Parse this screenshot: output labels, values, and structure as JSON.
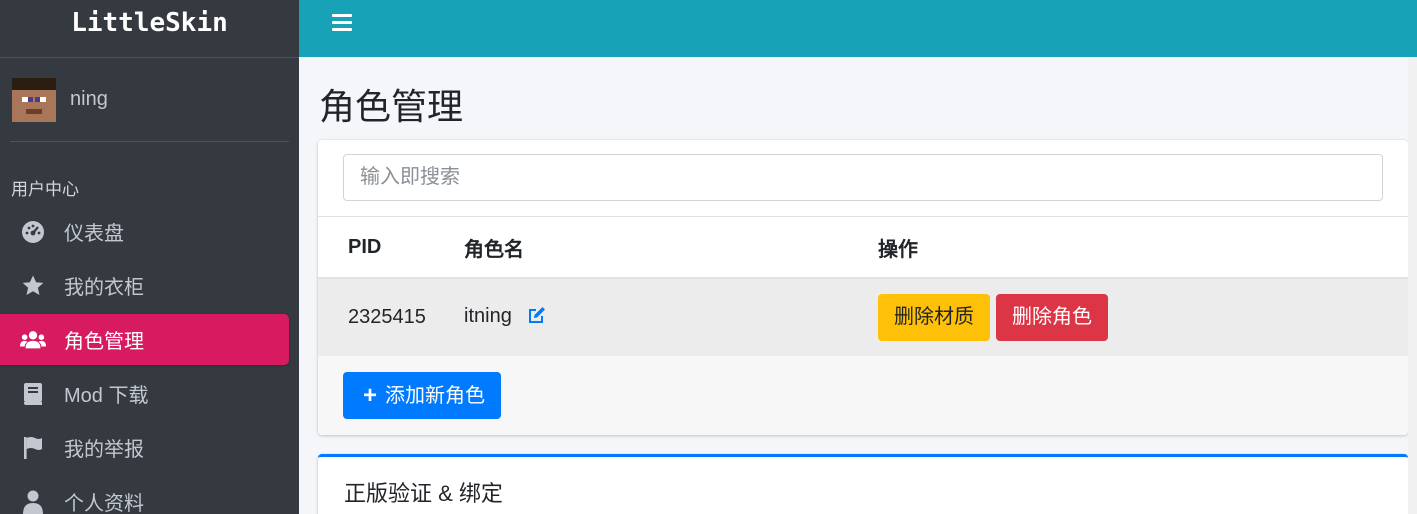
{
  "brand": {
    "name": "LittleSkin"
  },
  "user": {
    "name": "ning"
  },
  "sidebar": {
    "header": "用户中心",
    "items": [
      {
        "label": "仪表盘",
        "icon": "dashboard-icon",
        "active": false
      },
      {
        "label": "我的衣柜",
        "icon": "star-icon",
        "active": false
      },
      {
        "label": "角色管理",
        "icon": "users-icon",
        "active": true
      },
      {
        "label": "Mod 下载",
        "icon": "book-icon",
        "active": false
      },
      {
        "label": "我的举报",
        "icon": "flag-icon",
        "active": false
      },
      {
        "label": "个人资料",
        "icon": "user-icon",
        "active": false
      }
    ]
  },
  "colors": {
    "topbar": "#17a2b8",
    "sidebar": "#343a40",
    "active": "#d81b60",
    "warning": "#ffc107",
    "danger": "#dc3545",
    "primary": "#007bff"
  },
  "main": {
    "title": "角色管理",
    "search": {
      "placeholder": "输入即搜索",
      "value": ""
    },
    "table": {
      "columns": [
        "PID",
        "角色名",
        "操作"
      ],
      "rows": [
        {
          "pid": "2325415",
          "name": "itning",
          "actions": [
            "删除材质",
            "删除角色"
          ]
        }
      ]
    },
    "add_button": "添加新角色",
    "section2_title": "正版验证 & 绑定"
  }
}
